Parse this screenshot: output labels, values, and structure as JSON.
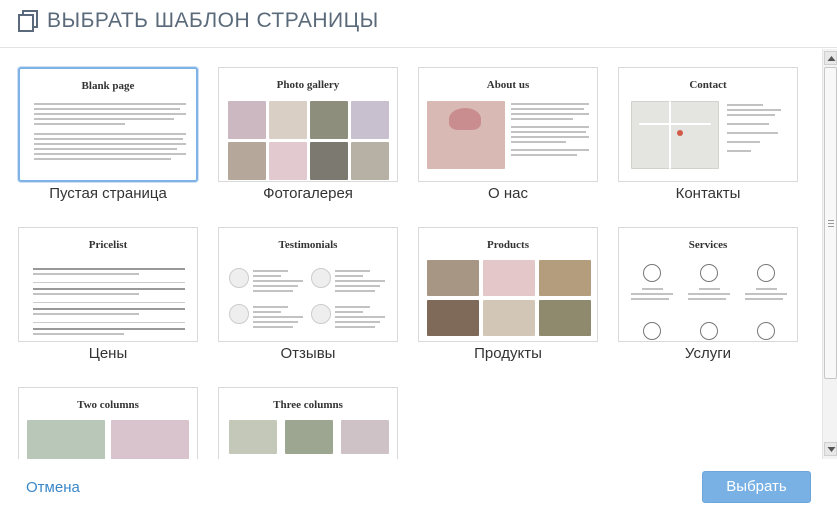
{
  "dialog": {
    "title": "ВЫБРАТЬ ШАБЛОН СТРАНИЦЫ"
  },
  "templates": [
    {
      "thumb_title": "Blank page",
      "label": "Пустая страница",
      "selected": true
    },
    {
      "thumb_title": "Photo gallery",
      "label": "Фотогалерея",
      "selected": false
    },
    {
      "thumb_title": "About us",
      "label": "О нас",
      "selected": false
    },
    {
      "thumb_title": "Contact",
      "label": "Контакты",
      "selected": false
    },
    {
      "thumb_title": "Pricelist",
      "label": "Цены",
      "selected": false
    },
    {
      "thumb_title": "Testimonials",
      "label": "Отзывы",
      "selected": false
    },
    {
      "thumb_title": "Products",
      "label": "Продукты",
      "selected": false
    },
    {
      "thumb_title": "Services",
      "label": "Услуги",
      "selected": false
    },
    {
      "thumb_title": "Two columns",
      "label": "",
      "selected": false
    },
    {
      "thumb_title": "Three columns",
      "label": "",
      "selected": false
    }
  ],
  "footer": {
    "cancel_label": "Отмена",
    "select_label": "Выбрать"
  },
  "colors": {
    "accent": "#79b1e4",
    "link": "#3a87c8",
    "selected_border": "#7fb2e5"
  }
}
